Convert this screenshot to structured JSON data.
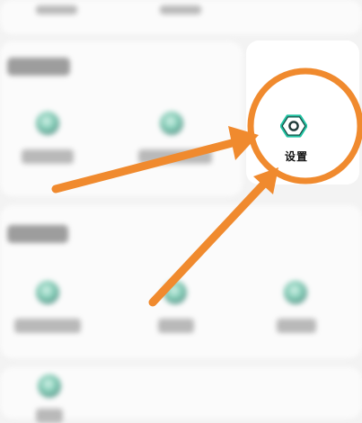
{
  "settings_item": {
    "label": "设置",
    "icon": "settings-hexagon-icon"
  },
  "colors": {
    "accent_orange": "#f08a2e",
    "icon_teal": "#20c3a2",
    "icon_dark": "#1f3a39"
  },
  "annotation": {
    "type": "callout",
    "marks": [
      "circle",
      "arrow",
      "arrow"
    ]
  }
}
